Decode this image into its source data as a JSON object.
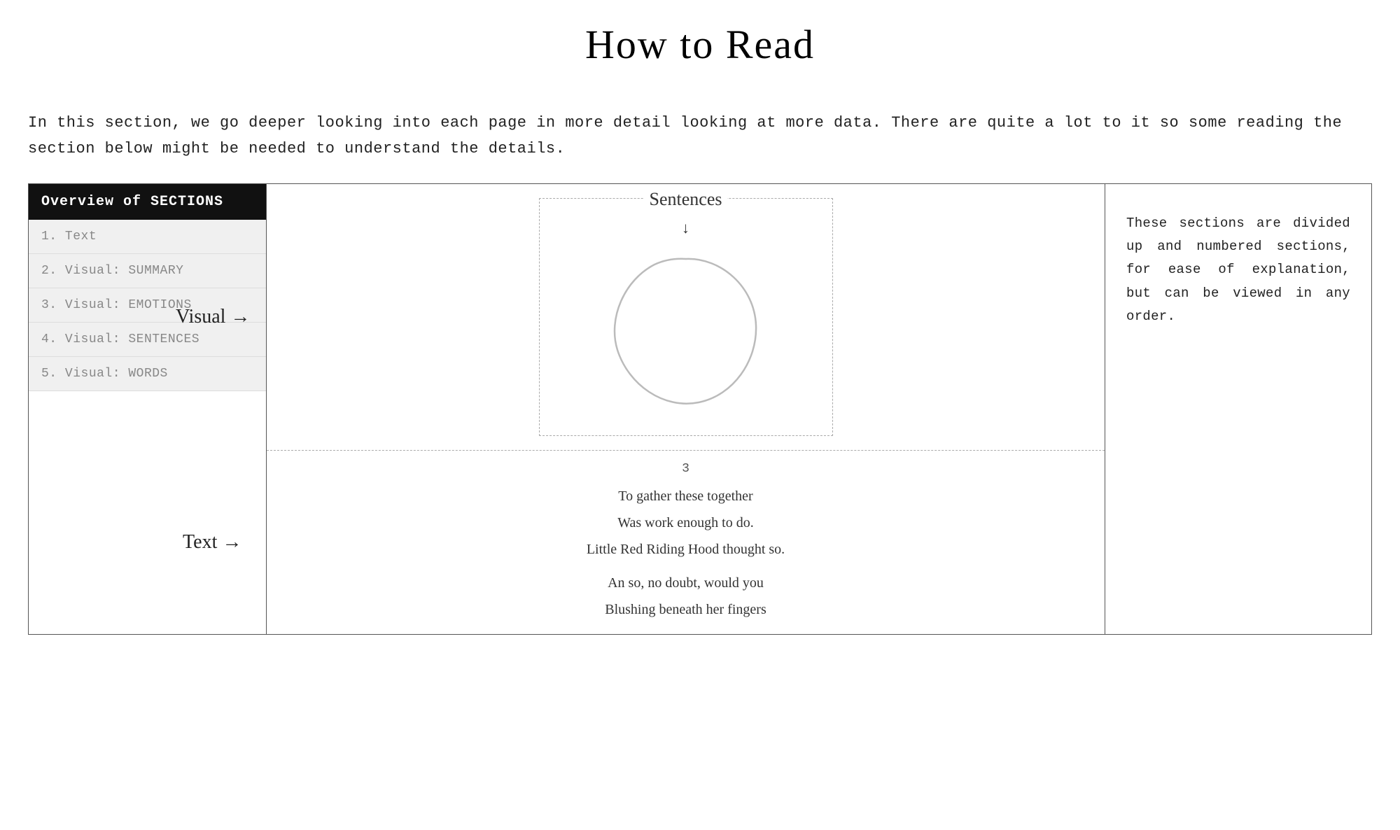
{
  "title": "How to Read",
  "intro": "In this section, we go deeper looking into each page in more detail looking at more data. There are quite a lot to it so some reading the section below might be needed to understand the details.",
  "sidebar": {
    "header": "Overview of SECTIONS",
    "items": [
      {
        "number": "1.",
        "label": "Text"
      },
      {
        "number": "2.",
        "label": "Visual: SUMMARY"
      },
      {
        "number": "3.",
        "label": "Visual: EMOTIONS"
      },
      {
        "number": "4.",
        "label": "Visual: SENTENCES"
      },
      {
        "number": "5.",
        "label": "Visual: WORDS"
      }
    ]
  },
  "diagram": {
    "sentences_label": "Sentences",
    "sentences_arrow": "↓",
    "visual_arrow": "Visual →",
    "text_arrow": "Text →",
    "page_number": "3",
    "poem_lines_1": [
      "To gather these together",
      "Was work enough to do.",
      "Little Red Riding Hood thought so."
    ],
    "poem_lines_2": [
      "An so, no doubt, would you",
      "Blushing beneath her fingers"
    ]
  },
  "right_panel": {
    "text": "These sections are divided up and numbered sections, for ease of explanation, but can be viewed in any order."
  }
}
